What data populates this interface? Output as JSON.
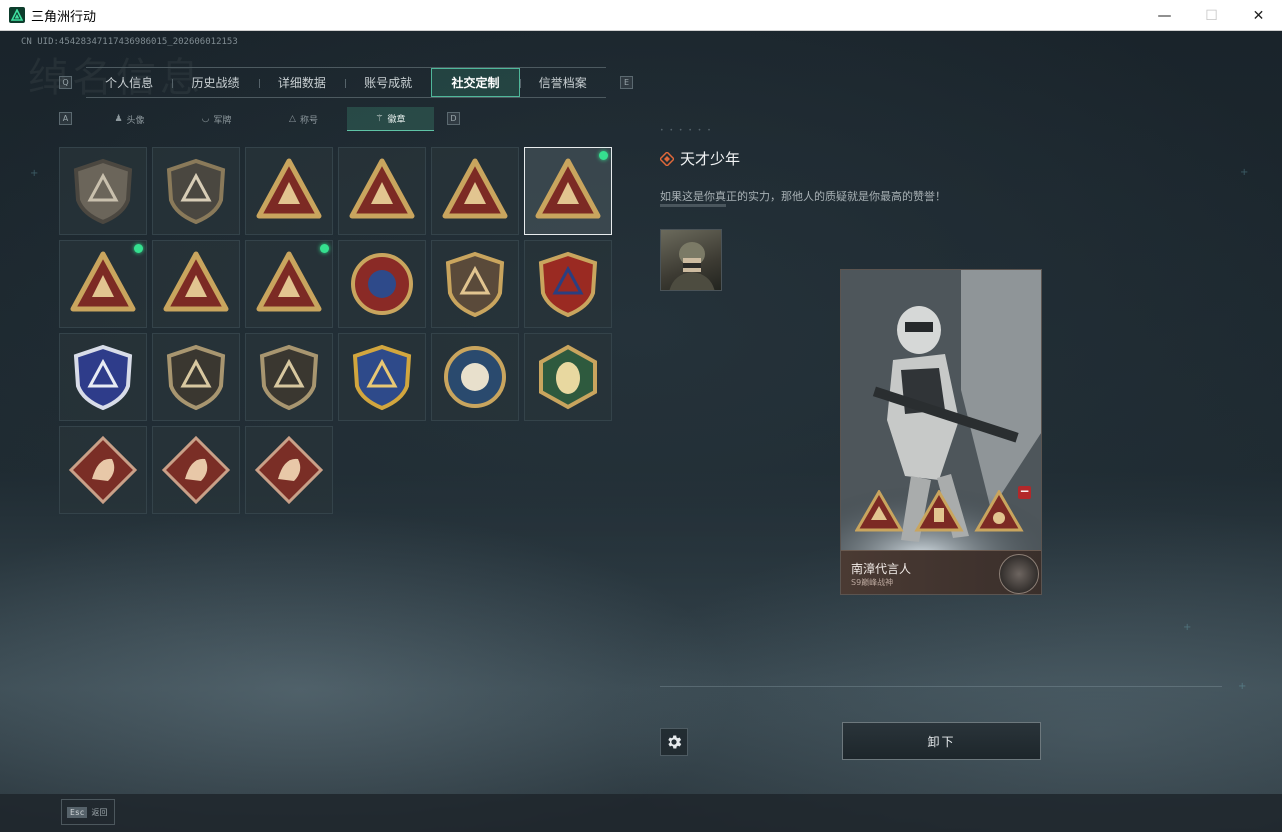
{
  "window": {
    "title": "三角洲行动",
    "minimize": "—",
    "maximize": "☐",
    "close": "✕"
  },
  "header": {
    "uid": "CN UID:45428347117436986015_202606012153",
    "watermark": "绰名信息"
  },
  "main_tabs": {
    "left_hotkey": "Q",
    "right_hotkey": "E",
    "items": [
      {
        "label": "个人信息",
        "active": false
      },
      {
        "label": "历史战绩",
        "active": false
      },
      {
        "label": "详细数据",
        "active": false
      },
      {
        "label": "账号成就",
        "active": false
      },
      {
        "label": "社交定制",
        "active": true
      },
      {
        "label": "信誉档案",
        "active": false
      }
    ]
  },
  "sub_tabs": {
    "left_hotkey": "A",
    "right_hotkey": "D",
    "items": [
      {
        "icon": "person-icon",
        "glyph": "♟",
        "label": "头像",
        "active": false
      },
      {
        "icon": "rank-icon",
        "glyph": "◡",
        "label": "军牌",
        "active": false
      },
      {
        "icon": "title-icon",
        "glyph": "△",
        "label": "称号",
        "active": false
      },
      {
        "icon": "medal-icon",
        "glyph": "⚚",
        "label": "徽章",
        "active": true
      }
    ]
  },
  "badges": [
    {
      "name": "badge-delta-shield",
      "shape": "shield",
      "frame": "#4b4740",
      "fill": "#6b655a",
      "accent": "#c9c0ad",
      "new": false,
      "selected": false
    },
    {
      "name": "badge-helicopter",
      "shape": "shield",
      "frame": "#8a7a5a",
      "fill": "#4a4740",
      "accent": "#d8cdb6",
      "new": false,
      "selected": false
    },
    {
      "name": "badge-s8-tank",
      "shape": "triangle",
      "frame": "#c9a55e",
      "fill": "#7c2a24",
      "accent": "#e2c590",
      "new": false,
      "selected": false
    },
    {
      "name": "badge-triangle-wings",
      "shape": "triangle",
      "frame": "#c9a55e",
      "fill": "#7c2a24",
      "accent": "#e2c590",
      "new": false,
      "selected": false
    },
    {
      "name": "badge-number-one",
      "shape": "triangle",
      "frame": "#c9a55e",
      "fill": "#7c2a24",
      "accent": "#e2c590",
      "new": false,
      "selected": false
    },
    {
      "name": "badge-usb-drive",
      "shape": "triangle",
      "frame": "#c9a55e",
      "fill": "#7c2a24",
      "accent": "#e2c590",
      "new": true,
      "selected": true
    },
    {
      "name": "badge-crest-wings",
      "shape": "triangle",
      "frame": "#c9a55e",
      "fill": "#7c2a24",
      "accent": "#e2c590",
      "new": true,
      "selected": false
    },
    {
      "name": "badge-soldiers",
      "shape": "triangle",
      "frame": "#c9a55e",
      "fill": "#7c2a24",
      "accent": "#e2c590",
      "new": false,
      "selected": false
    },
    {
      "name": "badge-soldiers-laurel",
      "shape": "triangle",
      "frame": "#c9a55e",
      "fill": "#7c2a24",
      "accent": "#e2c590",
      "new": true,
      "selected": false
    },
    {
      "name": "badge-star-round",
      "shape": "round",
      "frame": "#c9a55e",
      "fill": "#8a2a26",
      "accent": "#2e4a8a",
      "new": false,
      "selected": false
    },
    {
      "name": "badge-shield-arrows",
      "shape": "shield",
      "frame": "#c9a55e",
      "fill": "#5a4a3a",
      "accent": "#e2c590",
      "new": false,
      "selected": false
    },
    {
      "name": "badge-stars-shield",
      "shape": "shield",
      "frame": "#c9a55e",
      "fill": "#9a2a22",
      "accent": "#2a3f80",
      "new": false,
      "selected": false
    },
    {
      "name": "badge-diamond-shield",
      "shape": "shield",
      "frame": "#d8dce8",
      "fill": "#2e3c8a",
      "accent": "#e8ecf4",
      "new": false,
      "selected": false
    },
    {
      "name": "badge-no-smoking",
      "shape": "shield",
      "frame": "#a89670",
      "fill": "#3a3730",
      "accent": "#d8c8a0",
      "new": false,
      "selected": false
    },
    {
      "name": "badge-rifle-crossed",
      "shape": "shield",
      "frame": "#a89670",
      "fill": "#3a3730",
      "accent": "#d8c8a0",
      "new": false,
      "selected": false
    },
    {
      "name": "badge-crosshair-star",
      "shape": "shield",
      "frame": "#d2a63e",
      "fill": "#2e4a8a",
      "accent": "#e8c874",
      "new": false,
      "selected": false
    },
    {
      "name": "badge-eagle",
      "shape": "round",
      "frame": "#c9a55e",
      "fill": "#2a4a6e",
      "accent": "#e8e0cc",
      "new": false,
      "selected": false
    },
    {
      "name": "badge-wasp-hex",
      "shape": "hex",
      "frame": "#c9a55e",
      "fill": "#2e5a3e",
      "accent": "#e8d8a0",
      "new": false,
      "selected": false
    },
    {
      "name": "badge-dragon-a",
      "shape": "diamond",
      "frame": "#c9a088",
      "fill": "#7a2e26",
      "accent": "#e8c8a8",
      "new": false,
      "selected": false
    },
    {
      "name": "badge-dragon-b",
      "shape": "diamond",
      "frame": "#c9a088",
      "fill": "#7a2e26",
      "accent": "#e8c8a8",
      "new": false,
      "selected": false
    },
    {
      "name": "badge-runner",
      "shape": "diamond",
      "frame": "#c9a088",
      "fill": "#7a2e26",
      "accent": "#e8c8a8",
      "new": false,
      "selected": false
    }
  ],
  "detail": {
    "title": "天才少年",
    "description": "如果这是你真正的实力，那他人的质疑就是你最高的赞誉！"
  },
  "card": {
    "name": "南漳代言人",
    "subtitle": "S9巅峰战神",
    "remove_glyph": "−"
  },
  "actions": {
    "unequip": "卸下"
  },
  "footer": {
    "esc_key": "Esc",
    "esc_label": "返回"
  },
  "colors": {
    "accent": "#4fb79a",
    "new_dot": "#35e08f",
    "remove": "#b3282a",
    "diamond_icon": "#e0683a"
  }
}
